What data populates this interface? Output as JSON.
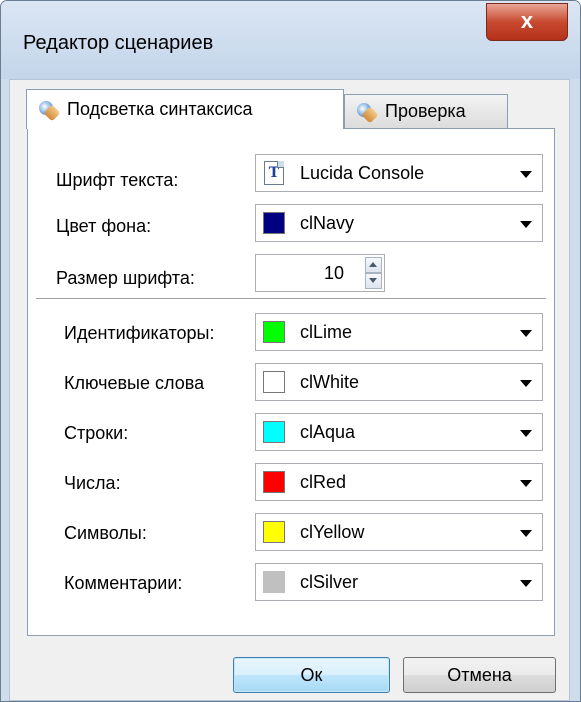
{
  "window": {
    "title": "Редактор сценариев",
    "close_label": "x"
  },
  "tabs": [
    {
      "label": "Подсветка синтаксиса",
      "icon": "gears-icon",
      "active": true
    },
    {
      "label": "Проверка",
      "icon": "gears-icon",
      "active": false
    }
  ],
  "general": {
    "font_label": "Шрифт текста:",
    "font_value": "Lucida Console",
    "font_icon": "truetype-font-icon",
    "bg_label": "Цвет фона:",
    "bg_value": "clNavy",
    "bg_color": "#000080",
    "size_label": "Размер шрифта:",
    "size_value": "10"
  },
  "syntax_colors": [
    {
      "label": "Идентификаторы:",
      "value": "clLime",
      "color": "#00ff00"
    },
    {
      "label": "Ключевые слова",
      "value": "clWhite",
      "color": "#ffffff"
    },
    {
      "label": "Строки:",
      "value": "clAqua",
      "color": "#00ffff"
    },
    {
      "label": "Числа:",
      "value": "clRed",
      "color": "#ff0000"
    },
    {
      "label": "Символы:",
      "value": "clYellow",
      "color": "#ffff00"
    },
    {
      "label": "Комментарии:",
      "value": "clSilver",
      "color": "#c0c0c0"
    }
  ],
  "buttons": {
    "ok": "Ок",
    "cancel": "Отмена"
  }
}
